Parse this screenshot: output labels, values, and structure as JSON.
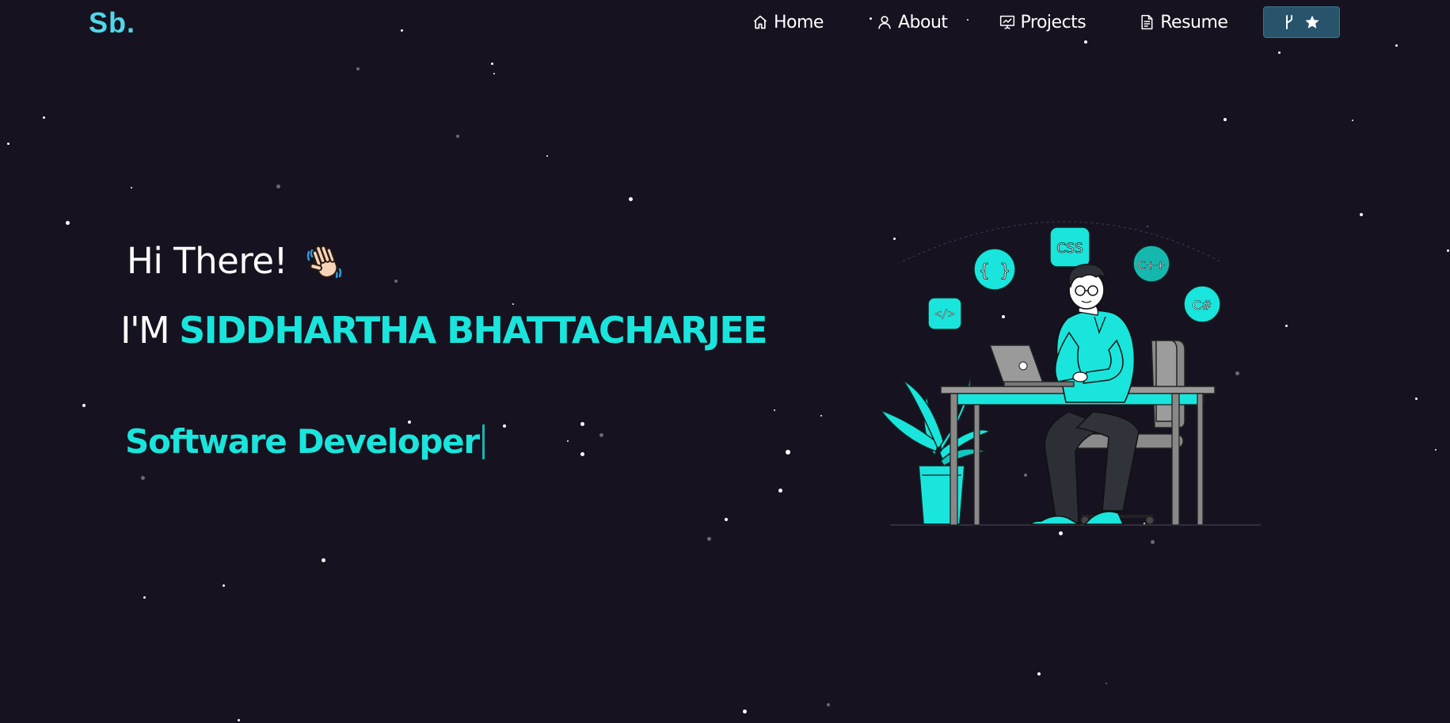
{
  "brand": {
    "logo": "Sb."
  },
  "nav": {
    "items": [
      {
        "label": "Home",
        "icon": "home-icon"
      },
      {
        "label": "About",
        "icon": "user-icon"
      },
      {
        "label": "Projects",
        "icon": "presentation-icon"
      },
      {
        "label": "Resume",
        "icon": "document-icon"
      }
    ],
    "repo_button": {
      "icons": [
        "git-fork-icon",
        "star-icon"
      ]
    }
  },
  "hero": {
    "greeting": "Hi There!",
    "greeting_emoji": "waving-hand-icon",
    "intro_prefix": "I'M",
    "name": "SIDDHARTHA BHATTACHARJEE",
    "typed_role": "Software Developer"
  },
  "illustration": {
    "badges": [
      "{ }",
      "CSS",
      "C++",
      "</>",
      "C#"
    ]
  },
  "colors": {
    "background": "#16121f",
    "accent": "#19e5dc",
    "logo": "#4fd8e8",
    "button": "#27546b"
  }
}
